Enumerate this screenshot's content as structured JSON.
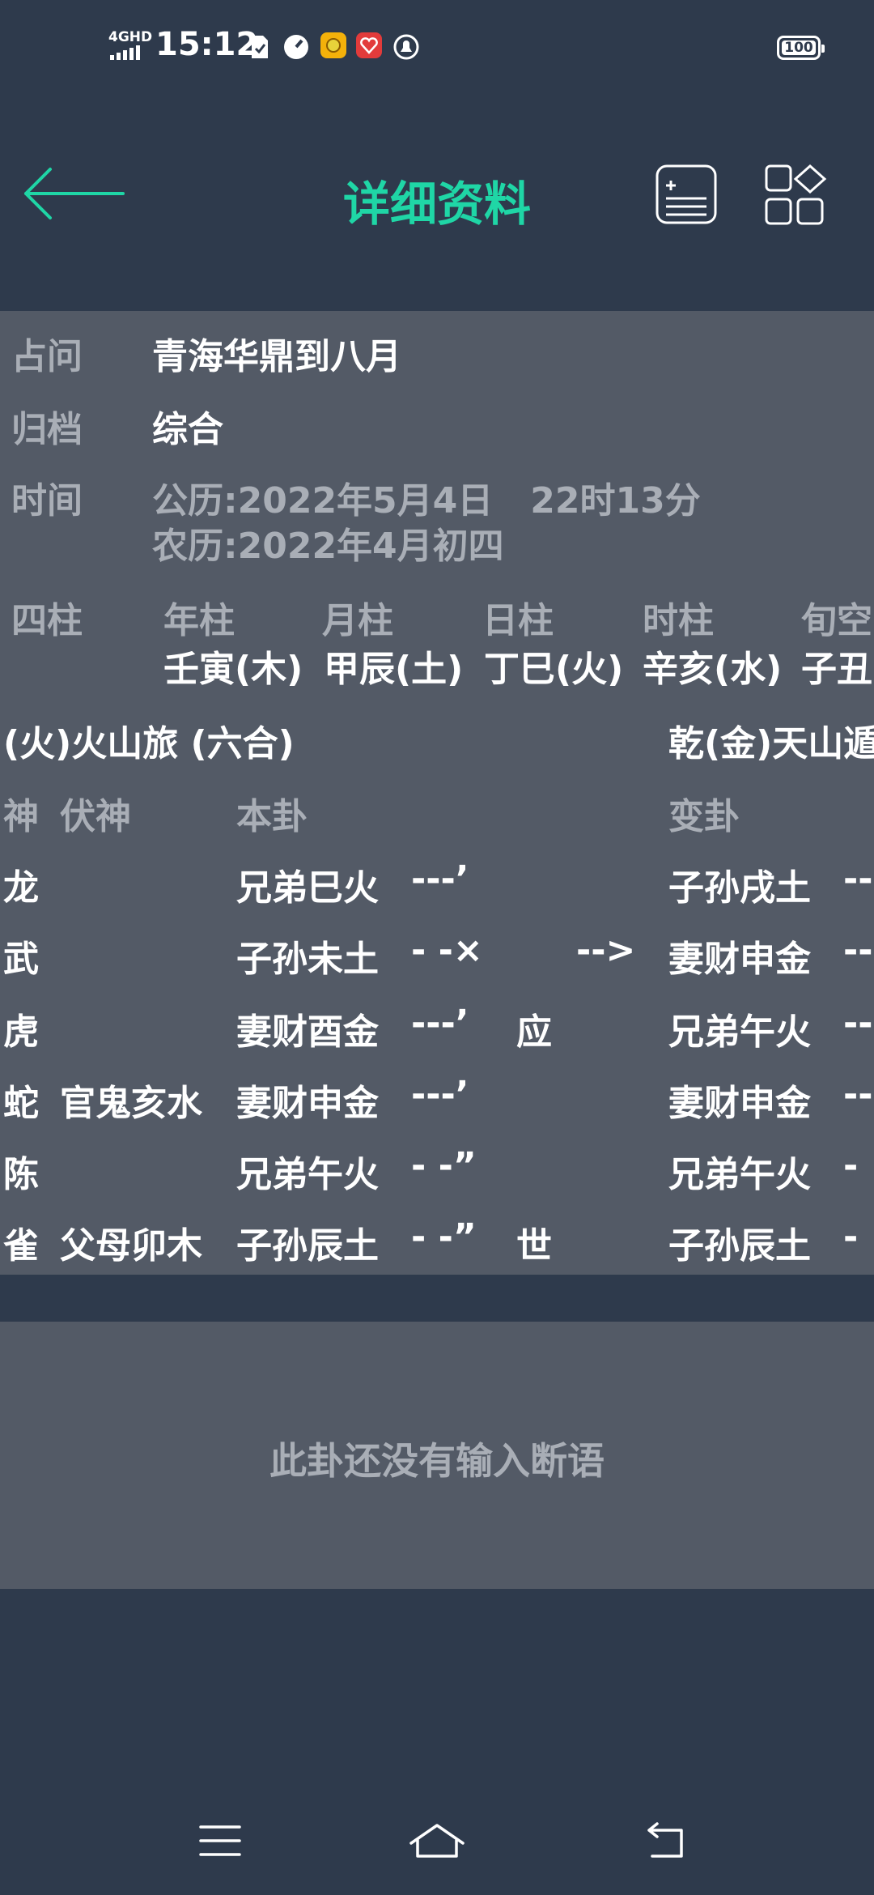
{
  "status": {
    "net": "4GHD",
    "time": "15:12",
    "battery": "100"
  },
  "header": {
    "title": "详细资料"
  },
  "info": {
    "question_label": "占问",
    "question_value": "青海华鼎到八月",
    "archive_label": "归档",
    "archive_value": "综合",
    "time_label": "时间",
    "solar": "公历:2022年5月4日   22时13分",
    "lunar": "农历:2022年4月初四"
  },
  "pillars": {
    "label": "四柱",
    "headers": [
      "年柱",
      "月柱",
      "日柱",
      "时柱",
      "旬空"
    ],
    "values": [
      "壬寅(木)",
      "甲辰(土)",
      "丁巳(火)",
      "辛亥(水)",
      "子丑"
    ]
  },
  "hexagram": {
    "main_name": "(火)火山旅 (六合)",
    "changed_name": "乾(金)天山遁",
    "col_shen": "神",
    "col_fushen": "伏神",
    "col_bengua": "本卦",
    "col_biangua": "变卦",
    "arrow": "-->",
    "lines": [
      {
        "shen": "龙",
        "fushen": "",
        "yao": "兄弟巳火",
        "sym": "---’",
        "mark": "",
        "bian": "子孙戌土",
        "bsym": "--"
      },
      {
        "shen": "武",
        "fushen": "",
        "yao": "子孙未土",
        "sym": "- -×",
        "mark": "",
        "bian": "妻财申金",
        "bsym": "--"
      },
      {
        "shen": "虎",
        "fushen": "",
        "yao": "妻财酉金",
        "sym": "---’",
        "mark": "应",
        "bian": "兄弟午火",
        "bsym": "--"
      },
      {
        "shen": "蛇",
        "fushen": "官鬼亥水",
        "yao": "妻财申金",
        "sym": "---’",
        "mark": "",
        "bian": "妻财申金",
        "bsym": "--"
      },
      {
        "shen": "陈",
        "fushen": "",
        "yao": "兄弟午火",
        "sym": "- -”",
        "mark": "",
        "bian": "兄弟午火",
        "bsym": "-"
      },
      {
        "shen": "雀",
        "fushen": "父母卯木",
        "yao": "子孙辰土",
        "sym": "- -”",
        "mark": "世",
        "bian": "子孙辰土",
        "bsym": "-"
      }
    ]
  },
  "note": {
    "empty_text": "此卦还没有输入断语"
  },
  "icons": {
    "back": "back-arrow-icon",
    "note": "add-note-icon",
    "apps": "apps-grid-icon",
    "menu": "menu-icon",
    "home": "home-icon",
    "return": "return-icon"
  },
  "colors": {
    "accent": "#1fd6a6",
    "background": "#2e3a4c",
    "panel": "#535a66",
    "label": "#a9aeb6"
  }
}
